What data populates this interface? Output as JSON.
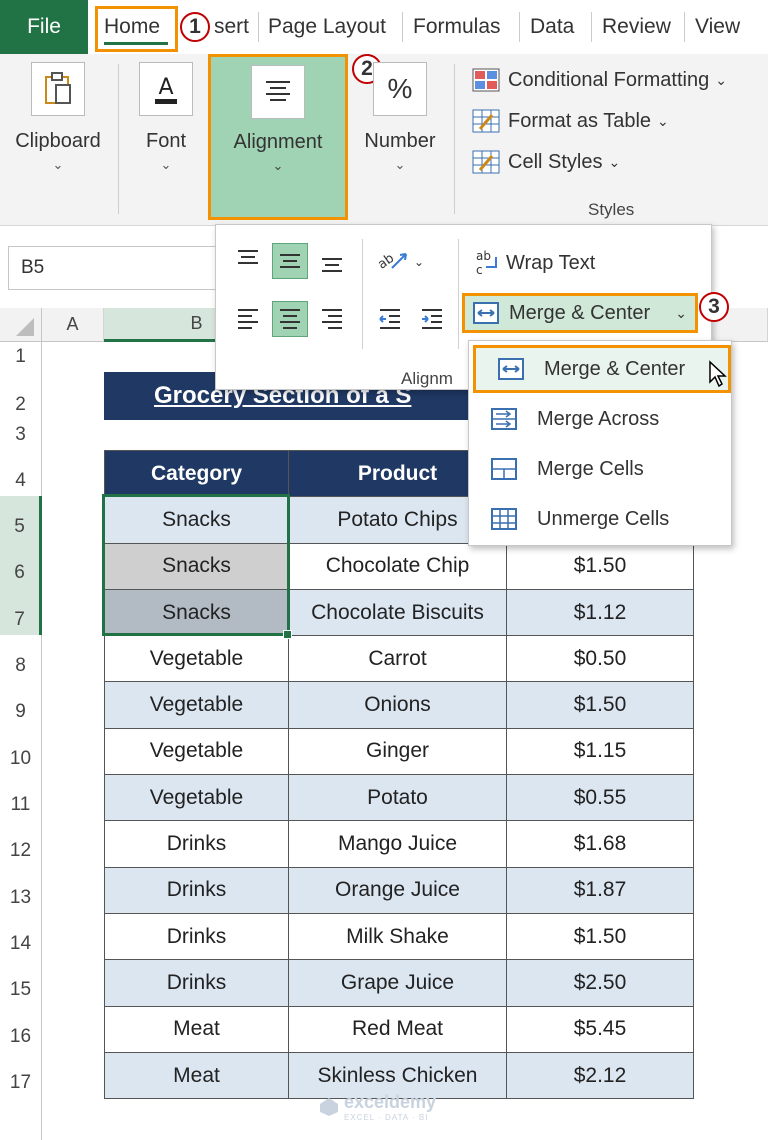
{
  "ribbon_tabs": [
    {
      "label": "File"
    },
    {
      "label": "Home"
    },
    {
      "label": "sert"
    },
    {
      "label": "Page Layout"
    },
    {
      "label": "Formulas"
    },
    {
      "label": "Data"
    },
    {
      "label": "Review"
    },
    {
      "label": "View"
    }
  ],
  "markers": {
    "step1": "1",
    "step2": "2",
    "step3": "3"
  },
  "ribbon_groups": {
    "clipboard": "Clipboard",
    "font": "Font",
    "alignment": "Alignment",
    "number": "Number",
    "styles": {
      "conditional": "Conditional Formatting",
      "format_table": "Format as Table",
      "cell_styles": "Cell Styles",
      "label": "Styles"
    }
  },
  "name_box": "B5",
  "alignment_dropdown": {
    "wrap_text": "Wrap Text",
    "merge_center": "Merge & Center",
    "label": "Alignm"
  },
  "merge_menu": [
    {
      "label": "Merge & Center",
      "icon": "merge-center-icon"
    },
    {
      "label": "Merge Across",
      "icon": "merge-across-icon"
    },
    {
      "label": "Merge Cells",
      "icon": "merge-cells-icon"
    },
    {
      "label": "Unmerge Cells",
      "icon": "unmerge-cells-icon"
    }
  ],
  "columns": [
    "A",
    "B"
  ],
  "rows": [
    "1",
    "2",
    "3",
    "4",
    "5",
    "6",
    "7",
    "8",
    "9",
    "10",
    "11",
    "12",
    "13",
    "14",
    "15",
    "16",
    "17"
  ],
  "sheet_title": "Grocery Section of  a S",
  "table": {
    "headers": [
      "Category",
      "Product",
      ""
    ],
    "rows": [
      [
        "Snacks",
        "Potato Chips",
        ""
      ],
      [
        "Snacks",
        "Chocolate Chip",
        "$1.50"
      ],
      [
        "Snacks",
        "Chocolate Biscuits",
        "$1.12"
      ],
      [
        "Vegetable",
        "Carrot",
        "$0.50"
      ],
      [
        "Vegetable",
        "Onions",
        "$1.50"
      ],
      [
        "Vegetable",
        "Ginger",
        "$1.15"
      ],
      [
        "Vegetable",
        "Potato",
        "$0.55"
      ],
      [
        "Drinks",
        "Mango Juice",
        "$1.68"
      ],
      [
        "Drinks",
        "Orange Juice",
        "$1.87"
      ],
      [
        "Drinks",
        "Milk Shake",
        "$1.50"
      ],
      [
        "Drinks",
        "Grape Juice",
        "$2.50"
      ],
      [
        "Meat",
        "Red Meat",
        "$5.45"
      ],
      [
        "Meat",
        "Skinless Chicken",
        "$2.12"
      ]
    ]
  },
  "watermark": {
    "name": "exceldemy",
    "tagline": "EXCEL · DATA · BI"
  },
  "colors": {
    "excel_green": "#217346",
    "header_navy": "#1f3864",
    "band_blue": "#dce6f1",
    "highlight_orange": "#f39200",
    "marker_red": "#c00000"
  }
}
